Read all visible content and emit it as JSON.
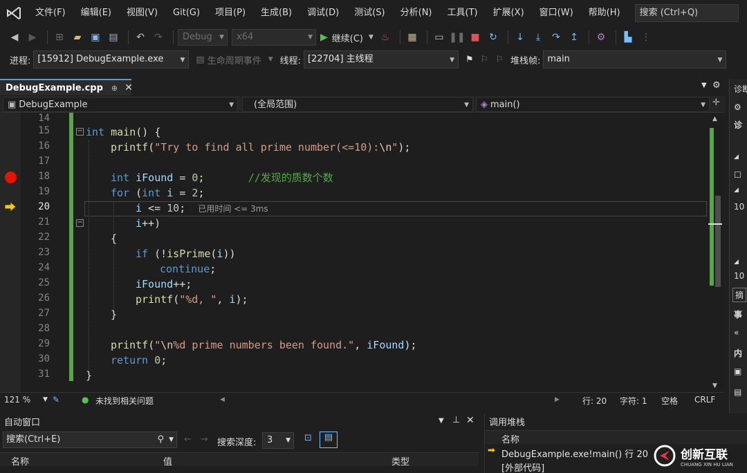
{
  "menubar": {
    "items": [
      "文件(F)",
      "编辑(E)",
      "视图(V)",
      "Git(G)",
      "项目(P)",
      "生成(B)",
      "调试(D)",
      "测试(S)",
      "分析(N)",
      "工具(T)",
      "扩展(X)",
      "窗口(W)",
      "帮助(H)"
    ],
    "search_placeholder": "搜索 (Ctrl+Q)"
  },
  "toolbar": {
    "config": "Debug",
    "platform": "x64",
    "continue_label": "继续(C)"
  },
  "debugbar": {
    "process_label": "进程:",
    "process_value": "[15912] DebugExample.exe",
    "lifecycle_label": "生命周期事件",
    "thread_label": "线程:",
    "thread_value": "[22704] 主线程",
    "stackframe_label": "堆栈帧:",
    "stackframe_value": "main"
  },
  "tab": {
    "filename": "DebugExample.cpp",
    "pin": "⊕",
    "close": "✕"
  },
  "navbar": {
    "project": "DebugExample",
    "scope": "(全局范围)",
    "member": "main()"
  },
  "editor": {
    "line_numbers": [
      "14",
      "15",
      "16",
      "17",
      "18",
      "19",
      "20",
      "21",
      "22",
      "23",
      "24",
      "25",
      "26",
      "27",
      "28",
      "29",
      "30",
      "31"
    ],
    "current_line": "20",
    "breakpoint_line": "18",
    "line15": {
      "kw": "int",
      "fn": "main",
      "rest": "() {"
    },
    "line16": {
      "fn": "printf",
      "open": "(",
      "str_a": "\"Try to find all prime number(<=10):",
      "esc": "\\n",
      "str_b": "\"",
      "close": ");"
    },
    "line18": {
      "kw": "int",
      "var": "iFound",
      "mid": " = ",
      "num": "0",
      "semi": ";",
      "cmt": "//发现的质数个数"
    },
    "line19": {
      "kw": "for",
      "open": " (",
      "kw2": "int",
      "var": "i",
      "mid": " = ",
      "num": "2",
      "semi": ";"
    },
    "line20": {
      "var": "i",
      "mid": " <= ",
      "num": "10",
      "semi": ";",
      "hint": "已用时间 <= 3ms"
    },
    "line21": {
      "var": "i",
      "rest": "++)"
    },
    "line22": {
      "text": "{"
    },
    "line23": {
      "kw": "if",
      "open": " (!",
      "fn": "isPrime",
      "p1": "(",
      "var": "i",
      "p2": "))"
    },
    "line24": {
      "kw": "continue",
      "semi": ";"
    },
    "line25": {
      "var": "iFound",
      "rest": "++;"
    },
    "line26": {
      "fn": "printf",
      "open": "(",
      "str": "\"%d, \"",
      "comma": ", ",
      "var": "i",
      "close": ");"
    },
    "line27": {
      "text": "}"
    },
    "line29": {
      "fn": "printf",
      "open": "(",
      "str_q": "\"",
      "esc": "\\n",
      "str_b": "%d prime numbers been found.\"",
      "comma": ", ",
      "var": "iFound",
      "close": ");"
    },
    "line30": {
      "kw": "return",
      "num": "0",
      "semi": ";"
    },
    "line31": {
      "text": "}"
    }
  },
  "statusbar": {
    "zoom": "121 %",
    "issues": "未找到相关问题",
    "line": "行: 20",
    "char": "字符: 1",
    "whitespace": "空格",
    "eol": "CRLF"
  },
  "rightpanel": {
    "title": "诊断",
    "items": [
      "诊",
      "10",
      "10",
      "摘",
      "事",
      "«",
      "内"
    ]
  },
  "autos": {
    "title": "自动窗口",
    "search_placeholder": "搜索(Ctrl+E)",
    "depth_label": "搜索深度:",
    "depth_value": "3",
    "columns": [
      "名称",
      "值",
      "类型"
    ]
  },
  "callstack": {
    "title": "调用堆栈",
    "column": "名称",
    "rows": [
      "DebugExample.exe!main() 行 20",
      "[外部代码]"
    ]
  },
  "watermark": {
    "text": "创新互联",
    "sub": "CHUANG XIN HU LIAN"
  },
  "colors": {
    "keyword": "#569cd6",
    "string": "#d69d85",
    "comment": "#57a64a",
    "function": "#dcdcaa",
    "variable": "#9cdcfe",
    "breakpoint": "#e51400",
    "current_arrow": "#f5c518"
  }
}
